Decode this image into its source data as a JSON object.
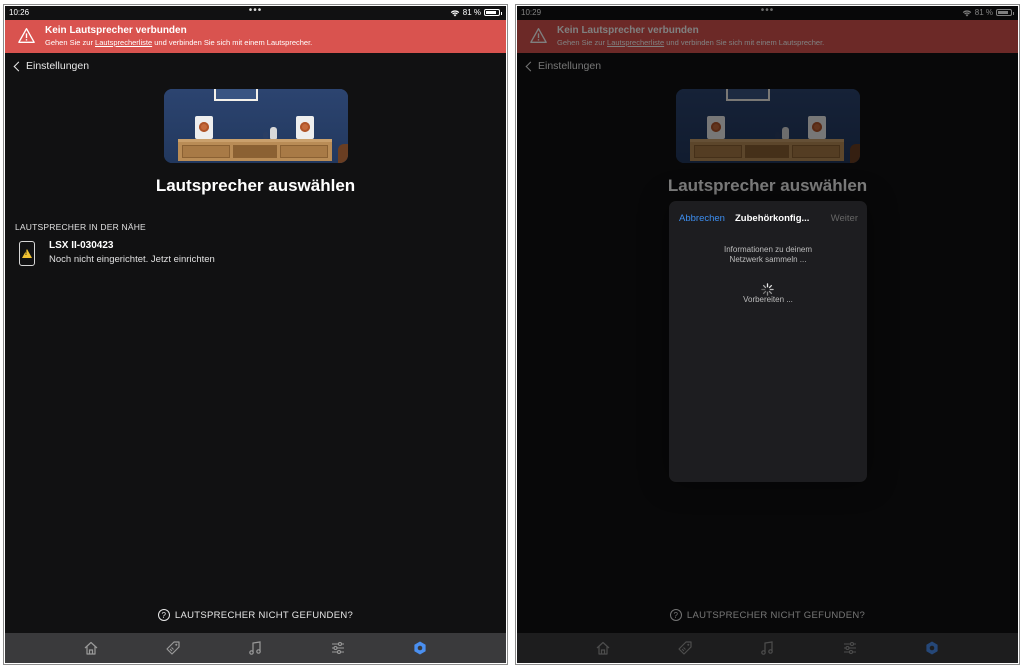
{
  "screens": {
    "left": {
      "status": {
        "time": "10:26",
        "battery": "81 %"
      },
      "banner": {
        "title": "Kein Lautsprecher verbunden",
        "sub_prefix": "Gehen Sie zur ",
        "sub_link": "Lautsprecherliste",
        "sub_suffix": " und verbinden Sie sich mit einem Lautsprecher."
      },
      "back_label": "Einstellungen",
      "heading": "Lautsprecher auswählen",
      "section": "LAUTSPRECHER IN DER NÄHE",
      "device": {
        "name": "LSX II-030423",
        "status": "Noch nicht eingerichtet. Jetzt einrichten"
      },
      "help": "LAUTSPRECHER NICHT GEFUNDEN?"
    },
    "right": {
      "status": {
        "time": "10:29",
        "battery": "81 %"
      },
      "banner": {
        "title": "Kein Lautsprecher verbunden",
        "sub_prefix": "Gehen Sie zur ",
        "sub_link": "Lautsprecherliste",
        "sub_suffix": " und verbinden Sie sich mit einem Lautsprecher."
      },
      "back_label": "Einstellungen",
      "heading": "Lautsprecher auswählen",
      "help": "LAUTSPRECHER NICHT GEFUNDEN?",
      "modal": {
        "cancel": "Abbrechen",
        "title": "Zubehörkonfig...",
        "next": "Weiter",
        "info_line1": "Informationen zu deinem",
        "info_line2": "Netzwerk sammeln ...",
        "preparing": "Vorbereiten ..."
      }
    }
  },
  "battery_level": 0.81,
  "tabs": [
    "home-icon",
    "tag-icon",
    "music-note-icon",
    "sliders-icon",
    "gear-icon"
  ],
  "colors": {
    "banner": "#d9534f",
    "accent": "#3d8ef0",
    "active_tab": "#4a8ff0",
    "tab_inactive": "#9a9a9a"
  }
}
